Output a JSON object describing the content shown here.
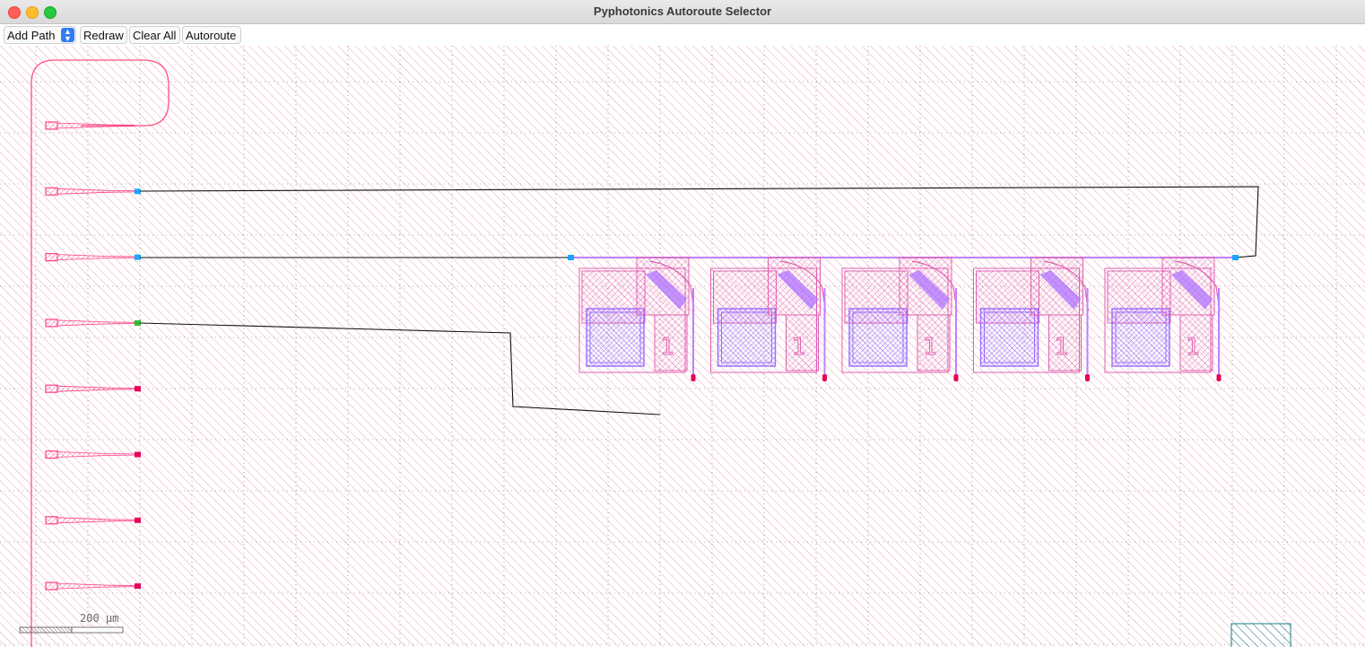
{
  "window": {
    "title": "Pyphotonics Autoroute Selector"
  },
  "toolbar": {
    "mode_select": {
      "value": "Add Path",
      "icon": "updown-chevron-icon"
    },
    "redraw_label": "Redraw",
    "clear_label": "Clear All",
    "autoroute_label": "Autoroute"
  },
  "canvas": {
    "scale_bar_label": "200 µm",
    "device_label": "1",
    "grating_coupler_count": 8,
    "device_count": 5,
    "colors": {
      "background_hatch": "#e88a9a",
      "grid_dots": "#555555",
      "coupler": "#ff3f8a",
      "device_outline": "#e060b0",
      "device_violet": "#b070ff",
      "port_cyan": "#1aa7ff",
      "port_green": "#2bbf2b",
      "port_red": "#e8005a",
      "route_line": "#000000",
      "loopback": "#ff4f80"
    }
  }
}
